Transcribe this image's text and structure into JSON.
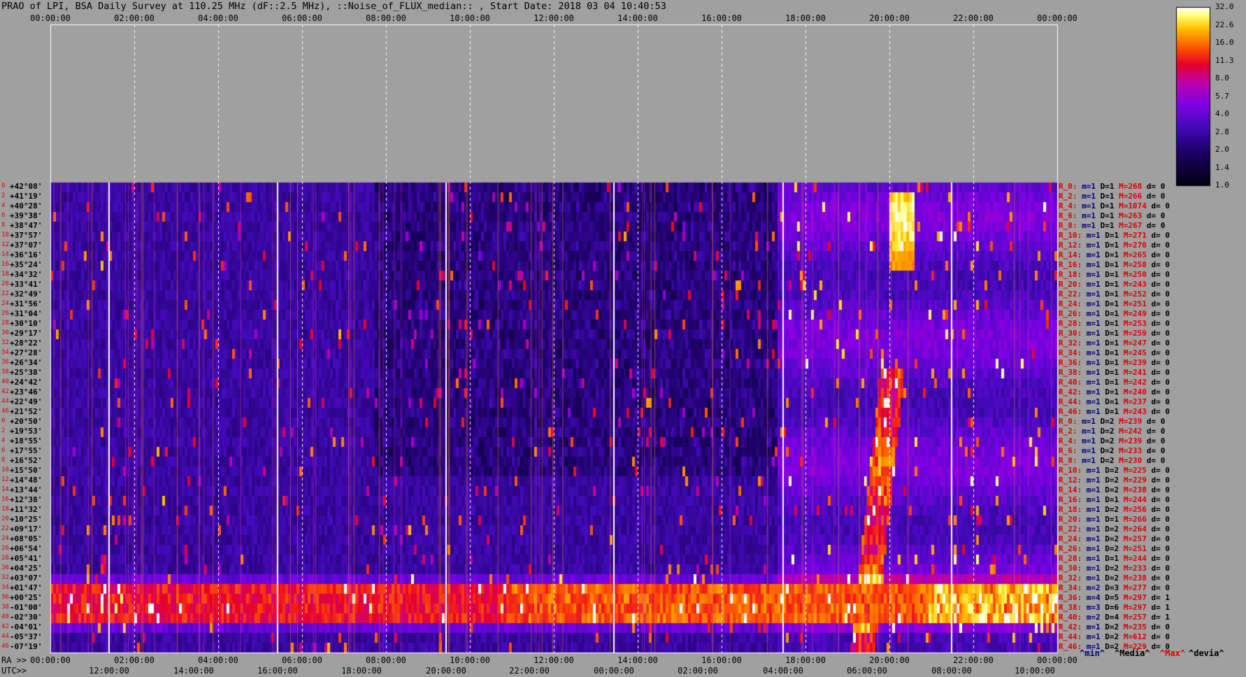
{
  "title": "PRAO of LPI, BSA Daily Survey at 110.25 MHz (dF::2.5 MHz), ::Noise_of_FLUX_median:: , Start Date: 2018 03 04 10:40:53",
  "top_axis_ticks": [
    "00:00:00",
    "02:00:00",
    "04:00:00",
    "06:00:00",
    "08:00:00",
    "10:00:00",
    "12:00:00",
    "14:00:00",
    "16:00:00",
    "18:00:00",
    "20:00:00",
    "22:00:00",
    "00:00:00"
  ],
  "ra_label": "RA >>",
  "ra_ticks": [
    "00:00:00",
    "02:00:00",
    "04:00:00",
    "06:00:00",
    "08:00:00",
    "10:00:00",
    "12:00:00",
    "14:00:00",
    "16:00:00",
    "18:00:00",
    "20:00:00",
    "22:00:00",
    "00:00:00"
  ],
  "utc_label": "UTC>>",
  "utc_ticks": [
    "12:00:00",
    "14:00:00",
    "16:00:00",
    "18:00:00",
    "20:00:00",
    "22:00:00",
    "00:00:00",
    "02:00:00",
    "04:00:00",
    "06:00:00",
    "08:00:00",
    "10:00:00"
  ],
  "colorbar": {
    "ticks": [
      "32.0",
      "22.6",
      "16.0",
      "11.3",
      "8.0",
      "5.7",
      "4.0",
      "2.8",
      "2.0",
      "1.4",
      "1.0"
    ],
    "colors": [
      "#000010",
      "#1a0060",
      "#5a10c8",
      "#9000e0",
      "#c800a0",
      "#e80020",
      "#ff6000",
      "#ffc000",
      "#ffff60",
      "#ffffff"
    ]
  },
  "legend": {
    "min": "^min^",
    "media": "^Media^",
    "max": "^Max^",
    "devia": "^devia^"
  },
  "chart_data": {
    "type": "heatmap",
    "title": "PRAO of LPI, BSA Daily Survey at 110.25 MHz (dF::2.5 MHz), ::Noise_of_FLUX_median:: , Start Date: 2018 03 04 10:40:53",
    "colorbar_range": [
      1.0,
      32.0
    ],
    "rows": [
      {
        "i": "0",
        "dec": "+42°08'",
        "R": "R_0:",
        "m": "m=1",
        "D": "D=1",
        "M": "M=268",
        "d": "d= 0"
      },
      {
        "i": "2",
        "dec": "+41°19'",
        "R": "R_2:",
        "m": "m=1",
        "D": "D=1",
        "M": "M=266",
        "d": "d= 0"
      },
      {
        "i": "4",
        "dec": "+40°28'",
        "R": "R_4:",
        "m": "m=1",
        "D": "D=1",
        "M": "M=1074",
        "d": "d= 0"
      },
      {
        "i": "6",
        "dec": "+39°38'",
        "R": "R_6:",
        "m": "m=1",
        "D": "D=1",
        "M": "M=263",
        "d": "d= 0"
      },
      {
        "i": "8",
        "dec": "+38°47'",
        "R": "R_8:",
        "m": "m=1",
        "D": "D=1",
        "M": "M=267",
        "d": "d= 0"
      },
      {
        "i": "10",
        "dec": "+37°57'",
        "R": "R_10:",
        "m": "m=1",
        "D": "D=1",
        "M": "M=271",
        "d": "d= 0"
      },
      {
        "i": "12",
        "dec": "+37°07'",
        "R": "R_12:",
        "m": "m=1",
        "D": "D=1",
        "M": "M=270",
        "d": "d= 0"
      },
      {
        "i": "14",
        "dec": "+36°16'",
        "R": "R_14:",
        "m": "m=1",
        "D": "D=1",
        "M": "M=265",
        "d": "d= 0"
      },
      {
        "i": "16",
        "dec": "+35°24'",
        "R": "R_16:",
        "m": "m=1",
        "D": "D=1",
        "M": "M=258",
        "d": "d= 0"
      },
      {
        "i": "18",
        "dec": "+34°32'",
        "R": "R_18:",
        "m": "m=1",
        "D": "D=1",
        "M": "M=250",
        "d": "d= 0"
      },
      {
        "i": "20",
        "dec": "+33°41'",
        "R": "R_20:",
        "m": "m=1",
        "D": "D=1",
        "M": "M=243",
        "d": "d= 0"
      },
      {
        "i": "22",
        "dec": "+32°49'",
        "R": "R_22:",
        "m": "m=1",
        "D": "D=1",
        "M": "M=252",
        "d": "d= 0"
      },
      {
        "i": "24",
        "dec": "+31°56'",
        "R": "R_24:",
        "m": "m=1",
        "D": "D=1",
        "M": "M=251",
        "d": "d= 0"
      },
      {
        "i": "26",
        "dec": "+31°04'",
        "R": "R_26:",
        "m": "m=1",
        "D": "D=1",
        "M": "M=249",
        "d": "d= 0"
      },
      {
        "i": "28",
        "dec": "+30°10'",
        "R": "R_28:",
        "m": "m=1",
        "D": "D=1",
        "M": "M=253",
        "d": "d= 0"
      },
      {
        "i": "30",
        "dec": "+29°17'",
        "R": "R_30:",
        "m": "m=1",
        "D": "D=1",
        "M": "M=259",
        "d": "d= 0"
      },
      {
        "i": "32",
        "dec": "+28°22'",
        "R": "R_32:",
        "m": "m=1",
        "D": "D=1",
        "M": "M=247",
        "d": "d= 0"
      },
      {
        "i": "34",
        "dec": "+27°28'",
        "R": "R_34:",
        "m": "m=1",
        "D": "D=1",
        "M": "M=245",
        "d": "d= 0"
      },
      {
        "i": "36",
        "dec": "+26°34'",
        "R": "R_36:",
        "m": "m=1",
        "D": "D=1",
        "M": "M=239",
        "d": "d= 0"
      },
      {
        "i": "38",
        "dec": "+25°38'",
        "R": "R_38:",
        "m": "m=1",
        "D": "D=1",
        "M": "M=241",
        "d": "d= 0"
      },
      {
        "i": "40",
        "dec": "+24°42'",
        "R": "R_40:",
        "m": "m=1",
        "D": "D=1",
        "M": "M=242",
        "d": "d= 0"
      },
      {
        "i": "42",
        "dec": "+23°46'",
        "R": "R_42:",
        "m": "m=1",
        "D": "D=1",
        "M": "M=240",
        "d": "d= 0"
      },
      {
        "i": "44",
        "dec": "+22°49'",
        "R": "R_44:",
        "m": "m=1",
        "D": "D=1",
        "M": "M=237",
        "d": "d= 0"
      },
      {
        "i": "46",
        "dec": "+21°52'",
        "R": "R_46:",
        "m": "m=1",
        "D": "D=1",
        "M": "M=243",
        "d": "d= 0"
      },
      {
        "i": "0",
        "dec": "+20°50'",
        "R": "R_0:",
        "m": "m=1",
        "D": "D=2",
        "M": "M=239",
        "d": "d= 0"
      },
      {
        "i": "2",
        "dec": "+19°53'",
        "R": "R_2:",
        "m": "m=1",
        "D": "D=2",
        "M": "M=242",
        "d": "d= 0"
      },
      {
        "i": "4",
        "dec": "+18°55'",
        "R": "R_4:",
        "m": "m=1",
        "D": "D=2",
        "M": "M=239",
        "d": "d= 0"
      },
      {
        "i": "6",
        "dec": "+17°55'",
        "R": "R_6:",
        "m": "m=1",
        "D": "D=2",
        "M": "M=233",
        "d": "d= 0"
      },
      {
        "i": "8",
        "dec": "+16°52'",
        "R": "R_8:",
        "m": "m=1",
        "D": "D=2",
        "M": "M=230",
        "d": "d= 0"
      },
      {
        "i": "10",
        "dec": "+15°50'",
        "R": "R_10:",
        "m": "m=1",
        "D": "D=2",
        "M": "M=225",
        "d": "d= 0"
      },
      {
        "i": "12",
        "dec": "+14°48'",
        "R": "R_12:",
        "m": "m=1",
        "D": "D=2",
        "M": "M=229",
        "d": "d= 0"
      },
      {
        "i": "14",
        "dec": "+13°44'",
        "R": "R_14:",
        "m": "m=1",
        "D": "D=2",
        "M": "M=238",
        "d": "d= 0"
      },
      {
        "i": "16",
        "dec": "+12°38'",
        "R": "R_16:",
        "m": "m=1",
        "D": "D=1",
        "M": "M=244",
        "d": "d= 0"
      },
      {
        "i": "18",
        "dec": "+11°32'",
        "R": "R_18:",
        "m": "m=1",
        "D": "D=2",
        "M": "M=256",
        "d": "d= 0"
      },
      {
        "i": "20",
        "dec": "+10°25'",
        "R": "R_20:",
        "m": "m=1",
        "D": "D=1",
        "M": "M=266",
        "d": "d= 0"
      },
      {
        "i": "22",
        "dec": "+09°17'",
        "R": "R_22:",
        "m": "m=1",
        "D": "D=2",
        "M": "M=264",
        "d": "d= 0"
      },
      {
        "i": "24",
        "dec": "+08°05'",
        "R": "R_24:",
        "m": "m=1",
        "D": "D=2",
        "M": "M=257",
        "d": "d= 0"
      },
      {
        "i": "26",
        "dec": "+06°54'",
        "R": "R_26:",
        "m": "m=1",
        "D": "D=2",
        "M": "M=251",
        "d": "d= 0"
      },
      {
        "i": "28",
        "dec": "+05°41'",
        "R": "R_28:",
        "m": "m=1",
        "D": "D=1",
        "M": "M=244",
        "d": "d= 0"
      },
      {
        "i": "30",
        "dec": "+04°25'",
        "R": "R_30:",
        "m": "m=1",
        "D": "D=2",
        "M": "M=233",
        "d": "d= 0"
      },
      {
        "i": "32",
        "dec": "+03°07'",
        "R": "R_32:",
        "m": "m=1",
        "D": "D=2",
        "M": "M=238",
        "d": "d= 0"
      },
      {
        "i": "34",
        "dec": "+01°47'",
        "R": "R_34:",
        "m": "m=2",
        "D": "D=3",
        "M": "M=277",
        "d": "d= 0"
      },
      {
        "i": "36",
        "dec": "+00°25'",
        "R": "R_36:",
        "m": "m=4",
        "D": "D=5",
        "M": "M=297",
        "d": "d= 1"
      },
      {
        "i": "38",
        "dec": "-01°00'",
        "R": "R_38:",
        "m": "m=3",
        "D": "D=6",
        "M": "M=297",
        "d": "d= 1"
      },
      {
        "i": "40",
        "dec": "-02°30'",
        "R": "R_40:",
        "m": "m=2",
        "D": "D=4",
        "M": "M=257",
        "d": "d= 1"
      },
      {
        "i": "42",
        "dec": "-04°01'",
        "R": "R_42:",
        "m": "m=1",
        "D": "D=2",
        "M": "M=235",
        "d": "d= 0"
      },
      {
        "i": "44",
        "dec": "-05°37'",
        "R": "R_44:",
        "m": "m=1",
        "D": "D=2",
        "M": "M=612",
        "d": "d= 0"
      },
      {
        "i": "46",
        "dec": "-07°19'",
        "R": "R_46:",
        "m": "m=1",
        "D": "D=2",
        "M": "M=229",
        "d": "d= 0"
      }
    ]
  }
}
